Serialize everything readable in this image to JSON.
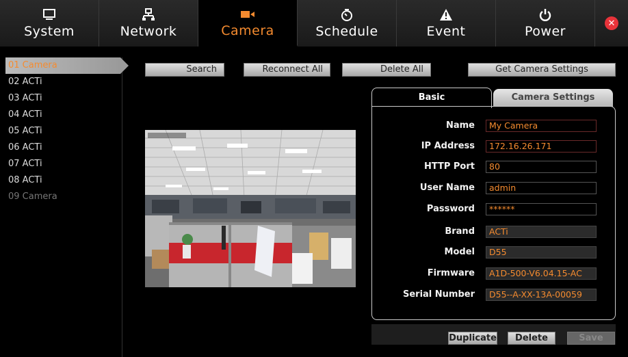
{
  "nav": {
    "tabs": [
      {
        "label": "System",
        "icon": "monitor-icon"
      },
      {
        "label": "Network",
        "icon": "network-icon"
      },
      {
        "label": "Camera",
        "icon": "camera-icon",
        "active": true
      },
      {
        "label": "Schedule",
        "icon": "clock-icon"
      },
      {
        "label": "Event",
        "icon": "alert-icon"
      },
      {
        "label": "Power",
        "icon": "power-icon"
      }
    ],
    "close_icon": "close-icon",
    "accent_color": "#f58b2f"
  },
  "sidebar": {
    "items": [
      {
        "label": "01 Camera",
        "state": "selected"
      },
      {
        "label": "02 ACTi"
      },
      {
        "label": "03 ACTi"
      },
      {
        "label": "04 ACTi"
      },
      {
        "label": "05 ACTi"
      },
      {
        "label": "06 ACTi"
      },
      {
        "label": "07 ACTi"
      },
      {
        "label": "08 ACTi"
      },
      {
        "label": "09 Camera",
        "state": "empty"
      }
    ]
  },
  "toolbar": {
    "search": "Search",
    "reconnect_all": "Reconnect All",
    "delete_all": "Delete All",
    "get_settings": "Get Camera Settings"
  },
  "settings": {
    "tabs": {
      "basic": "Basic",
      "camera_settings": "Camera Settings"
    },
    "fields": [
      {
        "label": "Name",
        "value": "My Camera"
      },
      {
        "label": "IP Address",
        "value": "172.16.26.171"
      },
      {
        "label": "HTTP Port",
        "value": "80"
      },
      {
        "label": "User Name",
        "value": "admin"
      },
      {
        "label": "Password",
        "value": "******"
      },
      {
        "label": "Brand",
        "value": "ACTi"
      },
      {
        "label": "Model",
        "value": "D55"
      },
      {
        "label": "Firmware",
        "value": "A1D-500-V6.04.15-AC"
      },
      {
        "label": "Serial Number",
        "value": "D55--A-XX-13A-00059"
      }
    ]
  },
  "footer": {
    "duplicate": "Duplicate",
    "delete": "Delete",
    "save": "Save"
  }
}
